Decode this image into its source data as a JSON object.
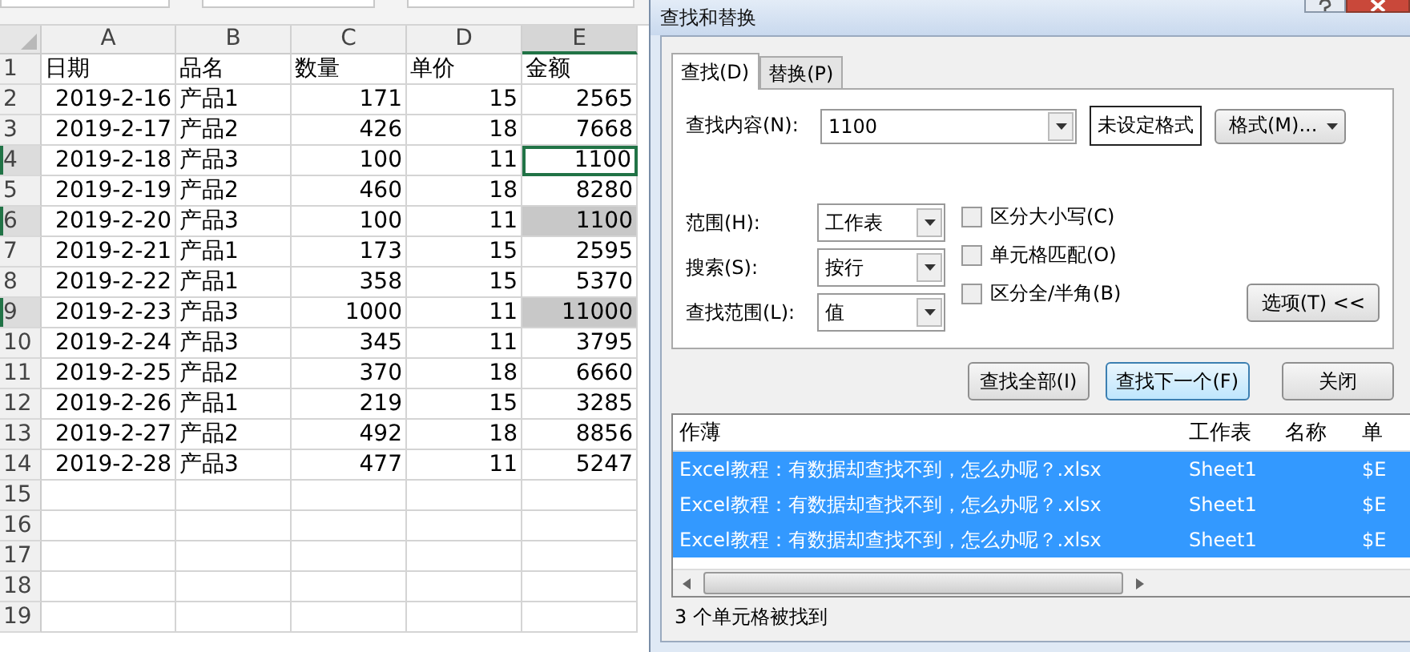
{
  "sheet": {
    "columns": [
      {
        "label": "A",
        "selected": false
      },
      {
        "label": "B",
        "selected": false
      },
      {
        "label": "C",
        "selected": false
      },
      {
        "label": "D",
        "selected": false
      },
      {
        "label": "E",
        "selected": true
      }
    ],
    "rows": [
      {
        "number": "1",
        "cells": [
          "日期",
          "品名",
          "数量",
          "单价",
          "金额"
        ],
        "kind": "header",
        "active": false,
        "selected": false
      },
      {
        "number": "2",
        "cells": [
          "2019-2-16",
          "产品1",
          "171",
          "15",
          "2565"
        ],
        "kind": "data",
        "active": false,
        "selected": false
      },
      {
        "number": "3",
        "cells": [
          "2019-2-17",
          "产品2",
          "426",
          "18",
          "7668"
        ],
        "kind": "data",
        "active": false,
        "selected": false
      },
      {
        "number": "4",
        "cells": [
          "2019-2-18",
          "产品3",
          "100",
          "11",
          "1100"
        ],
        "kind": "data",
        "active": true,
        "selected": true
      },
      {
        "number": "5",
        "cells": [
          "2019-2-19",
          "产品2",
          "460",
          "18",
          "8280"
        ],
        "kind": "data",
        "active": false,
        "selected": false
      },
      {
        "number": "6",
        "cells": [
          "2019-2-20",
          "产品3",
          "100",
          "11",
          "1100"
        ],
        "kind": "data",
        "active": false,
        "selected": true
      },
      {
        "number": "7",
        "cells": [
          "2019-2-21",
          "产品1",
          "173",
          "15",
          "2595"
        ],
        "kind": "data",
        "active": false,
        "selected": false
      },
      {
        "number": "8",
        "cells": [
          "2019-2-22",
          "产品1",
          "358",
          "15",
          "5370"
        ],
        "kind": "data",
        "active": false,
        "selected": false
      },
      {
        "number": "9",
        "cells": [
          "2019-2-23",
          "产品3",
          "1000",
          "11",
          "11000"
        ],
        "kind": "data",
        "active": false,
        "selected": true
      },
      {
        "number": "10",
        "cells": [
          "2019-2-24",
          "产品3",
          "345",
          "11",
          "3795"
        ],
        "kind": "data",
        "active": false,
        "selected": false
      },
      {
        "number": "11",
        "cells": [
          "2019-2-25",
          "产品2",
          "370",
          "18",
          "6660"
        ],
        "kind": "data",
        "active": false,
        "selected": false
      },
      {
        "number": "12",
        "cells": [
          "2019-2-26",
          "产品1",
          "219",
          "15",
          "3285"
        ],
        "kind": "data",
        "active": false,
        "selected": false
      },
      {
        "number": "13",
        "cells": [
          "2019-2-27",
          "产品2",
          "492",
          "18",
          "8856"
        ],
        "kind": "data",
        "active": false,
        "selected": false
      },
      {
        "number": "14",
        "cells": [
          "2019-2-28",
          "产品3",
          "477",
          "11",
          "5247"
        ],
        "kind": "data",
        "active": false,
        "selected": false
      },
      {
        "number": "15",
        "cells": [],
        "kind": "empty",
        "active": false,
        "selected": false
      },
      {
        "number": "16",
        "cells": [],
        "kind": "empty",
        "active": false,
        "selected": false
      },
      {
        "number": "17",
        "cells": [],
        "kind": "empty",
        "active": false,
        "selected": false
      },
      {
        "number": "18",
        "cells": [],
        "kind": "empty",
        "active": false,
        "selected": false
      },
      {
        "number": "19",
        "cells": [],
        "kind": "empty",
        "active": false,
        "selected": false
      }
    ]
  },
  "dialog": {
    "title": "查找和替换",
    "tabs": [
      {
        "label": "查找(D)",
        "selected": true
      },
      {
        "label": "替换(P)",
        "selected": false
      }
    ],
    "find": {
      "label": "查找内容(N):",
      "value": "1100",
      "format_preview": "未设定格式",
      "format_button": "格式(M)..."
    },
    "dropdowns": [
      {
        "label": "范围(H):",
        "value": "工作表"
      },
      {
        "label": "搜索(S):",
        "value": "按行"
      },
      {
        "label": "查找范围(L):",
        "value": "值"
      }
    ],
    "checkboxes": [
      {
        "label": "区分大小写(C)",
        "checked": false
      },
      {
        "label": "单元格匹配(O)",
        "checked": false
      },
      {
        "label": "区分全/半角(B)",
        "checked": false
      }
    ],
    "options_button": "选项(T) <<",
    "buttons": [
      {
        "label": "查找全部(I)",
        "focused": false
      },
      {
        "label": "查找下一个(F)",
        "focused": true
      },
      {
        "label": "关闭",
        "focused": false
      }
    ],
    "results": {
      "columns": [
        "作薄",
        "工作表",
        "名称",
        "单"
      ],
      "rows": [
        {
          "cells": [
            "Excel教程：有数据却查找不到，怎么办呢？.xlsx",
            "Sheet1",
            "",
            "$E"
          ],
          "selected": true
        },
        {
          "cells": [
            "Excel教程：有数据却查找不到，怎么办呢？.xlsx",
            "Sheet1",
            "",
            "$E"
          ],
          "selected": true
        },
        {
          "cells": [
            "Excel教程：有数据却查找不到，怎么办呢？.xlsx",
            "Sheet1",
            "",
            "$E"
          ],
          "selected": true
        }
      ]
    },
    "status": "3 个单元格被找到"
  }
}
